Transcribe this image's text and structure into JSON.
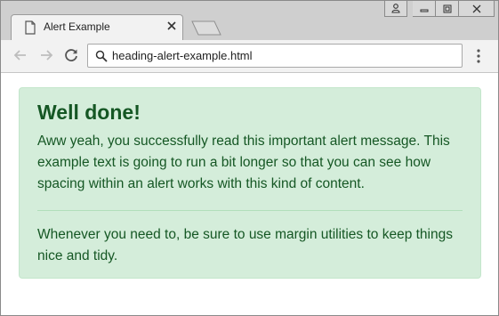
{
  "browser": {
    "tab": {
      "title": "Alert Example"
    },
    "address_bar": {
      "url": "heading-alert-example.html"
    },
    "icons": [
      "document-icon",
      "tab-close-icon",
      "new-tab-icon",
      "user-icon",
      "minimize-icon",
      "restore-icon",
      "window-close-icon",
      "back-icon",
      "forward-icon",
      "reload-icon",
      "search-icon",
      "menu-icon"
    ]
  },
  "alert": {
    "heading": "Well done!",
    "body": "Aww yeah, you successfully read this important alert message. This example text is going to run a bit longer so that you can see how spacing within an alert works with this kind of content.",
    "note": "Whenever you need to, be sure to use margin utilities to keep things nice and tidy.",
    "colors": {
      "background": "#d4edda",
      "border": "#c3e6cb",
      "text": "#155724"
    }
  }
}
